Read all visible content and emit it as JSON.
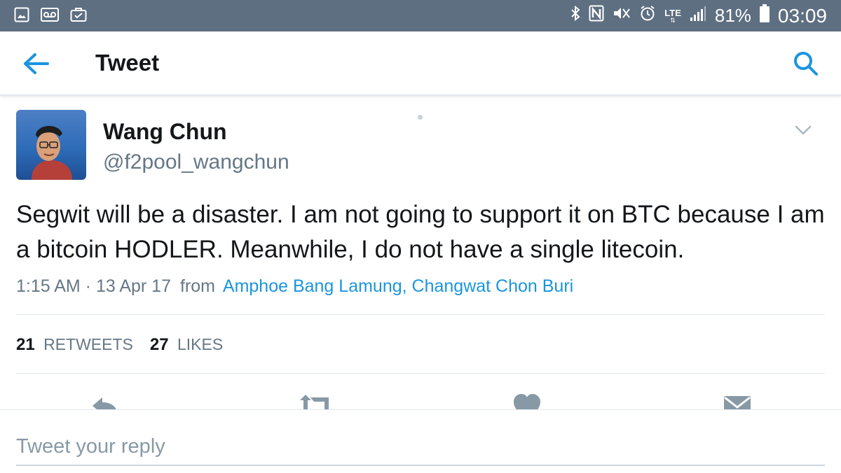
{
  "status_bar": {
    "battery": "81%",
    "time": "03:09",
    "network": "LTE",
    "left_icons": [
      "gallery-icon",
      "voicemail-icon",
      "briefcase-icon"
    ],
    "right_icons": [
      "bluetooth-icon",
      "nfc-icon",
      "mute-icon",
      "alarm-icon",
      "signal-icon",
      "battery-icon"
    ]
  },
  "header": {
    "title": "Tweet",
    "back_icon": "arrow-left-icon",
    "search_icon": "search-icon"
  },
  "tweet": {
    "author_name": "Wang Chun",
    "author_handle": "@f2pool_wangchun",
    "text": "Segwit will be a disaster. I am not going to support it on BTC because I am a bitcoin HODLER. Meanwhile, I do not have a single litecoin.",
    "time": "1:15 AM · 13 Apr 17",
    "from_label": "from",
    "location": "Amphoe Bang Lamung, Changwat Chon Buri",
    "retweets_count": "21",
    "retweets_label": "RETWEETS",
    "likes_count": "27",
    "likes_label": "LIKES"
  },
  "actions": [
    "reply-icon",
    "retweet-icon",
    "like-icon",
    "message-icon"
  ],
  "reply": {
    "placeholder": "Tweet your reply"
  },
  "colors": {
    "status_bar": "#5e6f82",
    "accent": "#1b95e0",
    "text": "#14171a",
    "secondary": "#657786",
    "divider": "#e1e8ed"
  }
}
